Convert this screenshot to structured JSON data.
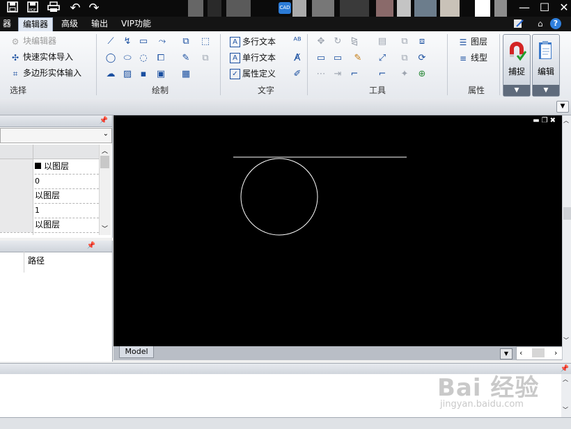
{
  "titlebar": {
    "app_badge": "CAD",
    "buttons": {
      "minimize": "—",
      "maximize": "☐",
      "close": "✕"
    }
  },
  "menu": {
    "items": [
      {
        "label": "器"
      },
      {
        "label": "编辑器",
        "active": true
      },
      {
        "label": "高级"
      },
      {
        "label": "输出"
      },
      {
        "label": "VIP功能"
      }
    ],
    "help_icon": "?"
  },
  "ribbon": {
    "select_group": {
      "label": "选择",
      "items": [
        "块编辑器",
        "快速实体导入",
        "多边形实体输入"
      ]
    },
    "draw_group": {
      "label": "绘制"
    },
    "text_group": {
      "label": "文字",
      "items": [
        "多行文本",
        "单行文本",
        "属性定义"
      ]
    },
    "tools_group": {
      "label": "工具"
    },
    "props_group": {
      "label": "属性",
      "items": [
        "图层",
        "线型"
      ]
    },
    "big_buttons": [
      "捕捉",
      "编辑"
    ]
  },
  "properties_panel": {
    "rows": [
      "以图层",
      "0",
      "以图层",
      "1",
      "以图层"
    ]
  },
  "files_panel": {
    "column_header": "路径"
  },
  "canvas": {
    "tab_label": "Model"
  },
  "watermark": {
    "brand": "Bai 经验",
    "url": "jingyan.baidu.com"
  }
}
